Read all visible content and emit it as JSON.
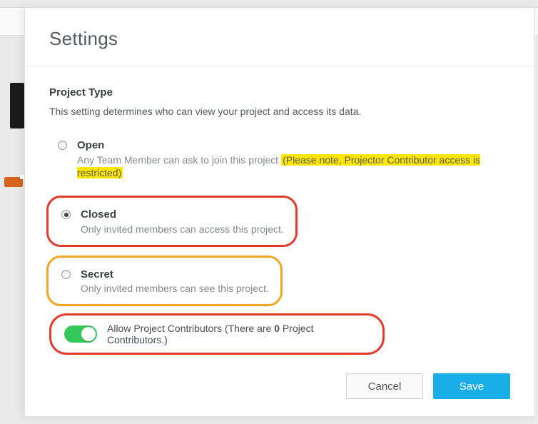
{
  "modal": {
    "title": "Settings"
  },
  "section": {
    "title": "Project Type",
    "description": "This setting determines who can view your project and access its data."
  },
  "options": {
    "open": {
      "label": "Open",
      "sub_prefix": "Any Team Member can ask to join this project ",
      "sub_highlight": "(Please note, Projector Contributor access is restricted)",
      "selected": false
    },
    "closed": {
      "label": "Closed",
      "sub": "Only invited members can access this project.",
      "selected": true
    },
    "secret": {
      "label": "Secret",
      "sub": "Only invited members can see this project.",
      "selected": false
    }
  },
  "toggle": {
    "on": true,
    "label_prefix": "Allow Project Contributors (There are ",
    "label_count": "0",
    "label_suffix": " Project Contributors.)"
  },
  "footer": {
    "cancel": "Cancel",
    "save": "Save"
  }
}
